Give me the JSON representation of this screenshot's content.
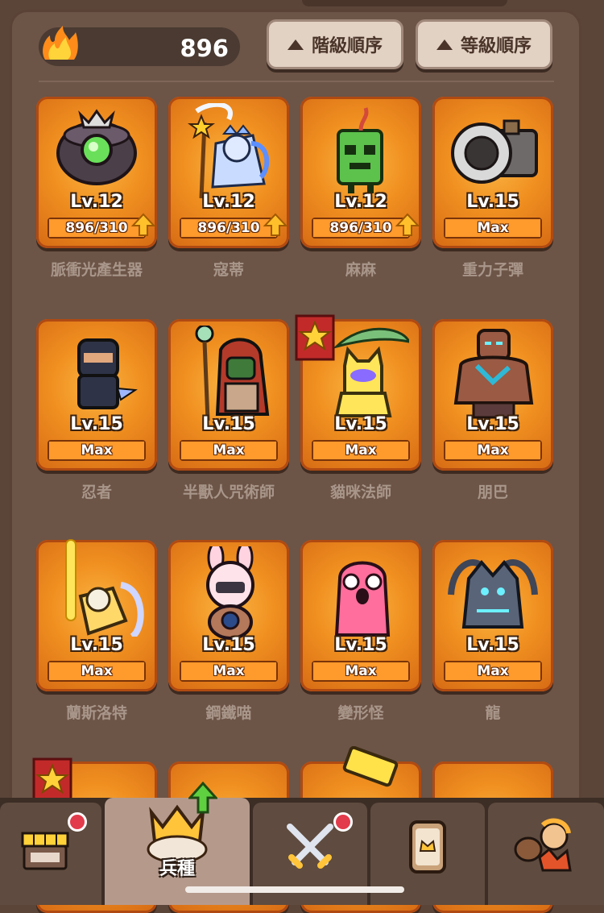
{
  "header": {
    "currency_icon": "flame-icon",
    "currency_value": "896",
    "sort_buttons": [
      {
        "label": "階級順序",
        "icon": "triangle-up-icon"
      },
      {
        "label": "等級順序",
        "icon": "triangle-up-icon"
      }
    ]
  },
  "units": [
    {
      "name": "脈衝光產生器",
      "level": "Lv.12",
      "progress": "896/310",
      "upgradable": true,
      "icon": "pulse-light-generator-icon"
    },
    {
      "name": "寇蒂",
      "level": "Lv.12",
      "progress": "896/310",
      "upgradable": true,
      "icon": "ice-mage-icon"
    },
    {
      "name": "麻麻",
      "level": "Lv.12",
      "progress": "896/310",
      "upgradable": true,
      "icon": "cactus-icon"
    },
    {
      "name": "重力子彈",
      "level": "Lv.15",
      "progress": "Max",
      "upgradable": false,
      "icon": "cannon-icon"
    },
    {
      "name": "忍者",
      "level": "Lv.15",
      "progress": "Max",
      "upgradable": false,
      "icon": "ninja-icon"
    },
    {
      "name": "半獸人咒術師",
      "level": "Lv.15",
      "progress": "Max",
      "upgradable": false,
      "icon": "orc-shaman-icon"
    },
    {
      "name": "貓咪法師",
      "level": "Lv.15",
      "progress": "Max",
      "upgradable": false,
      "icon": "cat-mage-icon",
      "starred": true
    },
    {
      "name": "朋巴",
      "level": "Lv.15",
      "progress": "Max",
      "upgradable": false,
      "icon": "golem-icon"
    },
    {
      "name": "蘭斯洛特",
      "level": "Lv.15",
      "progress": "Max",
      "upgradable": false,
      "icon": "knight-icon"
    },
    {
      "name": "鋼鐵喵",
      "level": "Lv.15",
      "progress": "Max",
      "upgradable": false,
      "icon": "bunny-robot-icon"
    },
    {
      "name": "變形怪",
      "level": "Lv.15",
      "progress": "Max",
      "upgradable": false,
      "icon": "pink-blob-icon"
    },
    {
      "name": "龍",
      "level": "Lv.15",
      "progress": "Max",
      "upgradable": false,
      "icon": "dragon-icon"
    }
  ],
  "tabbar": {
    "tabs": [
      {
        "icon": "shop-icon",
        "label": "",
        "badge": true
      },
      {
        "icon": "crown-icon",
        "label": "兵種",
        "badge": false,
        "active": true,
        "arrow": "green-up-arrow-icon"
      },
      {
        "icon": "crossed-swords-icon",
        "label": "",
        "badge": true
      },
      {
        "icon": "card-icon",
        "label": "",
        "badge": false
      },
      {
        "icon": "guild-icon",
        "label": "",
        "badge": false
      }
    ]
  },
  "colors": {
    "background": "#6c5447",
    "card_orange": "#f08f20",
    "progress_bar": "#e06f1a",
    "badge_red": "#e23b4b",
    "upgrade_arrow": "#ffc02c"
  }
}
